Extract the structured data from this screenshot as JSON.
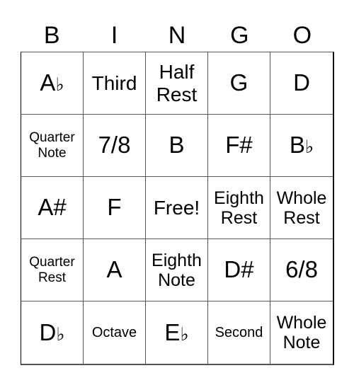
{
  "title_letters": [
    "B",
    "I",
    "N",
    "G",
    "O"
  ],
  "cells": [
    {
      "text": "A",
      "accidental": "♭",
      "size": "xl"
    },
    {
      "text": "Third",
      "size": "lg"
    },
    {
      "text": "Half Rest",
      "size": "lg"
    },
    {
      "text": "G",
      "size": "xl"
    },
    {
      "text": "D",
      "size": "xl"
    },
    {
      "text": "Quarter Note",
      "size": "xs"
    },
    {
      "text": "7/8",
      "size": "xl"
    },
    {
      "text": "B",
      "size": "xl"
    },
    {
      "text": "F#",
      "size": "xl"
    },
    {
      "text": "B",
      "accidental": "♭",
      "size": "xl"
    },
    {
      "text": "A#",
      "size": "xl"
    },
    {
      "text": "F",
      "size": "xl"
    },
    {
      "text": "Free!",
      "size": "lg"
    },
    {
      "text": "Eighth Rest",
      "size": "md"
    },
    {
      "text": "Whole Rest",
      "size": "md"
    },
    {
      "text": "Quarter Rest",
      "size": "xs"
    },
    {
      "text": "A",
      "size": "xl"
    },
    {
      "text": "Eighth Note",
      "size": "md"
    },
    {
      "text": "D#",
      "size": "xl"
    },
    {
      "text": "6/8",
      "size": "xl"
    },
    {
      "text": "D",
      "accidental": "♭",
      "size": "xl"
    },
    {
      "text": "Octave",
      "size": "sm"
    },
    {
      "text": "E",
      "accidental": "♭",
      "size": "xl"
    },
    {
      "text": "Second",
      "size": "sm"
    },
    {
      "text": "Whole Note",
      "size": "md"
    }
  ]
}
